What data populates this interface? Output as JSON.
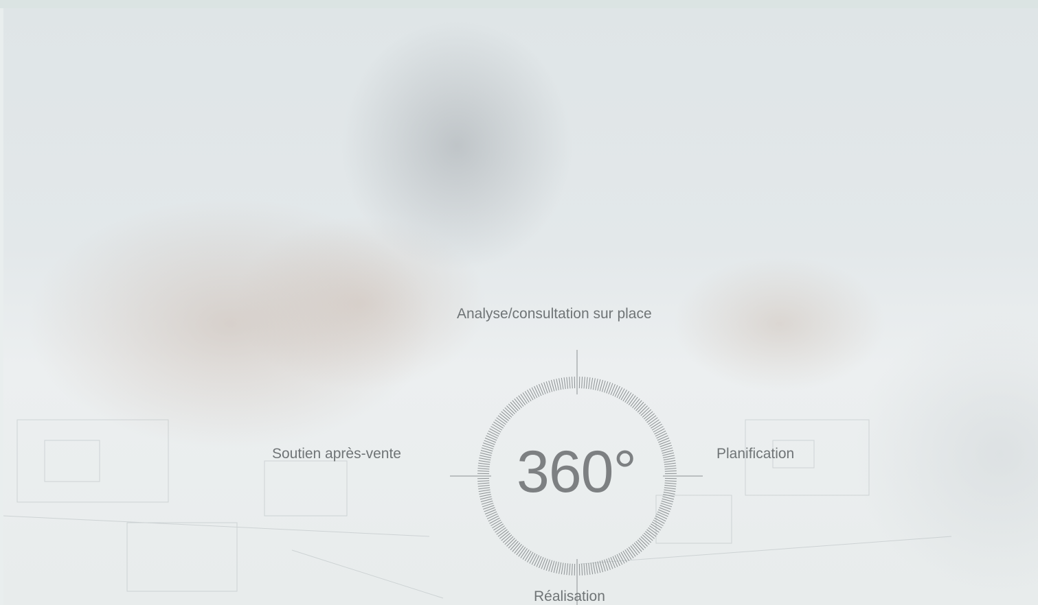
{
  "diagram": {
    "center_value": "360°",
    "labels": {
      "top": "Analyse/consultation sur place",
      "left": "Soutien après-vente",
      "right": "Planification",
      "bottom": "Réalisation"
    }
  },
  "colors": {
    "text": "#6f7476",
    "center_text": "#7d8082",
    "dial": "#8b9092"
  }
}
